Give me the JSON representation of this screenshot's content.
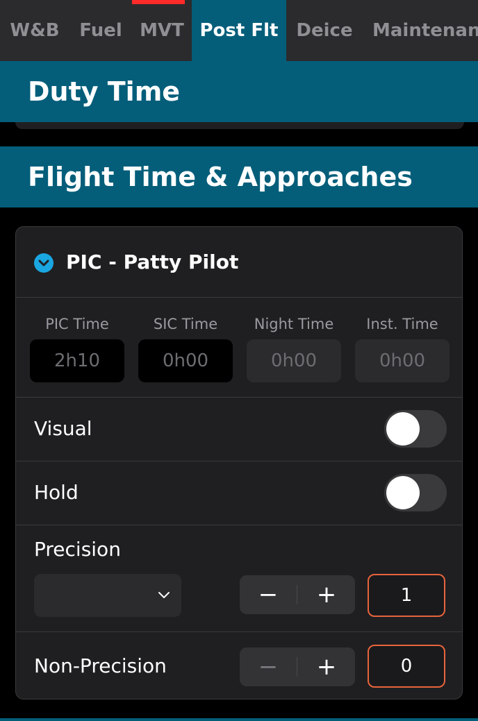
{
  "tabs": [
    {
      "label": "W&B",
      "active": false
    },
    {
      "label": "Fuel",
      "active": false
    },
    {
      "label": "MVT",
      "active": false
    },
    {
      "label": "Post Flt",
      "active": true
    },
    {
      "label": "Deice",
      "active": false
    },
    {
      "label": "Maintenan",
      "active": false
    }
  ],
  "sections": {
    "duty_time": "Duty Time",
    "flight_time": "Flight Time & Approaches"
  },
  "pilot_card": {
    "title": "PIC - Patty Pilot",
    "times": [
      {
        "label": "PIC Time",
        "value": "2h10"
      },
      {
        "label": "SIC Time",
        "value": "0h00"
      },
      {
        "label": "Night Time",
        "value": "0h00"
      },
      {
        "label": "Inst. Time",
        "value": "0h00"
      }
    ],
    "visual": {
      "label": "Visual",
      "on": false
    },
    "hold": {
      "label": "Hold",
      "on": false
    },
    "precision": {
      "label": "Precision",
      "selected": "",
      "minus": "−",
      "plus": "+",
      "count": "1"
    },
    "non_precision": {
      "label": "Non-Precision",
      "minus": "−",
      "plus": "+",
      "count": "0"
    }
  },
  "colors": {
    "accent_teal": "#045e7a",
    "active_marker": "#ff2a2a",
    "chevron_blue": "#1aa6e0",
    "counter_border": "#e8643c"
  }
}
